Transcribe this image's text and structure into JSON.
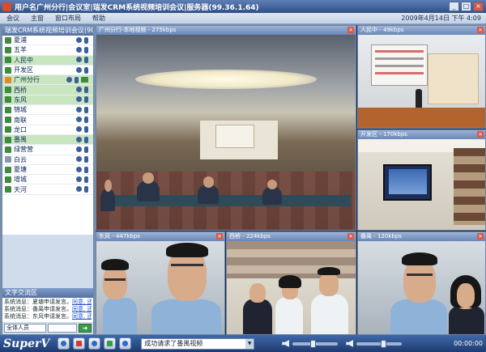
{
  "window": {
    "title": "用户名广州分行|会议室|瑞发CRM系统视频培训会议|服务器(99.36.1.64)"
  },
  "menu": {
    "items": [
      "会议",
      "主窗",
      "窗口布局",
      "帮助"
    ],
    "datetime": "2009年4月14日 下午 4:09"
  },
  "user_panel": {
    "header": "瑞发CRM系统视频培训会议(90)",
    "users": [
      {
        "name": "夏浦",
        "status": "green",
        "active": false,
        "screen": false
      },
      {
        "name": "五羊",
        "status": "green",
        "active": false,
        "screen": false
      },
      {
        "name": "人民中",
        "status": "green",
        "active": true,
        "screen": false
      },
      {
        "name": "开发区",
        "status": "green",
        "active": false,
        "screen": false
      },
      {
        "name": "广州分行",
        "status": "orange",
        "active": true,
        "screen": true
      },
      {
        "name": "西桥",
        "status": "green",
        "active": true,
        "screen": false
      },
      {
        "name": "东风",
        "status": "green",
        "active": true,
        "screen": false
      },
      {
        "name": "锦城",
        "status": "green",
        "active": false,
        "screen": false
      },
      {
        "name": "南联",
        "status": "green",
        "active": false,
        "screen": false
      },
      {
        "name": "龙口",
        "status": "green",
        "active": false,
        "screen": false
      },
      {
        "name": "番禺",
        "status": "green",
        "active": true,
        "screen": false
      },
      {
        "name": "绿营营",
        "status": "green",
        "active": false,
        "screen": false
      },
      {
        "name": "白云",
        "status": "gray",
        "active": false,
        "screen": false
      },
      {
        "name": "夏塘",
        "status": "green",
        "active": false,
        "screen": false
      },
      {
        "name": "增城",
        "status": "green",
        "active": false,
        "screen": false
      },
      {
        "name": "天河",
        "status": "green",
        "active": false,
        "screen": false
      }
    ]
  },
  "chat": {
    "header": "文字交流区",
    "lines": [
      {
        "text": "系统消息：夏塘申请发言。",
        "links": "同意, 还是 拒绝 还请求?"
      },
      {
        "text": "系统消息：番禺申请发言。",
        "links": "同意, 还是 拒绝 还请求?"
      },
      {
        "text": "系统消息：东风申请发言。",
        "links": "同意, 还是 拒绝 还请求?"
      }
    ],
    "target": "全体人员",
    "send_label": "➜"
  },
  "videos": [
    {
      "id": "main",
      "title": "广州分行-本地视频 - 275kbps"
    },
    {
      "id": "topright",
      "title": "人民中 - 49kbps"
    },
    {
      "id": "midright",
      "title": "开发区 - 170kbps"
    },
    {
      "id": "bottom1",
      "title": "东风 - 447kbps"
    },
    {
      "id": "bottom2",
      "title": "西桥 - 224kbps"
    },
    {
      "id": "bottom3",
      "title": "番禺 - 120kbps"
    }
  ],
  "bottombar": {
    "logo": "SuperV",
    "status_text": "成功请求了番禺视频",
    "volume_level": 0.45,
    "mic_level": 0.6,
    "clock": "00:00:00"
  },
  "icons": {
    "close": "close-icon",
    "camera": "camera-icon",
    "microphone": "microphone-icon"
  }
}
